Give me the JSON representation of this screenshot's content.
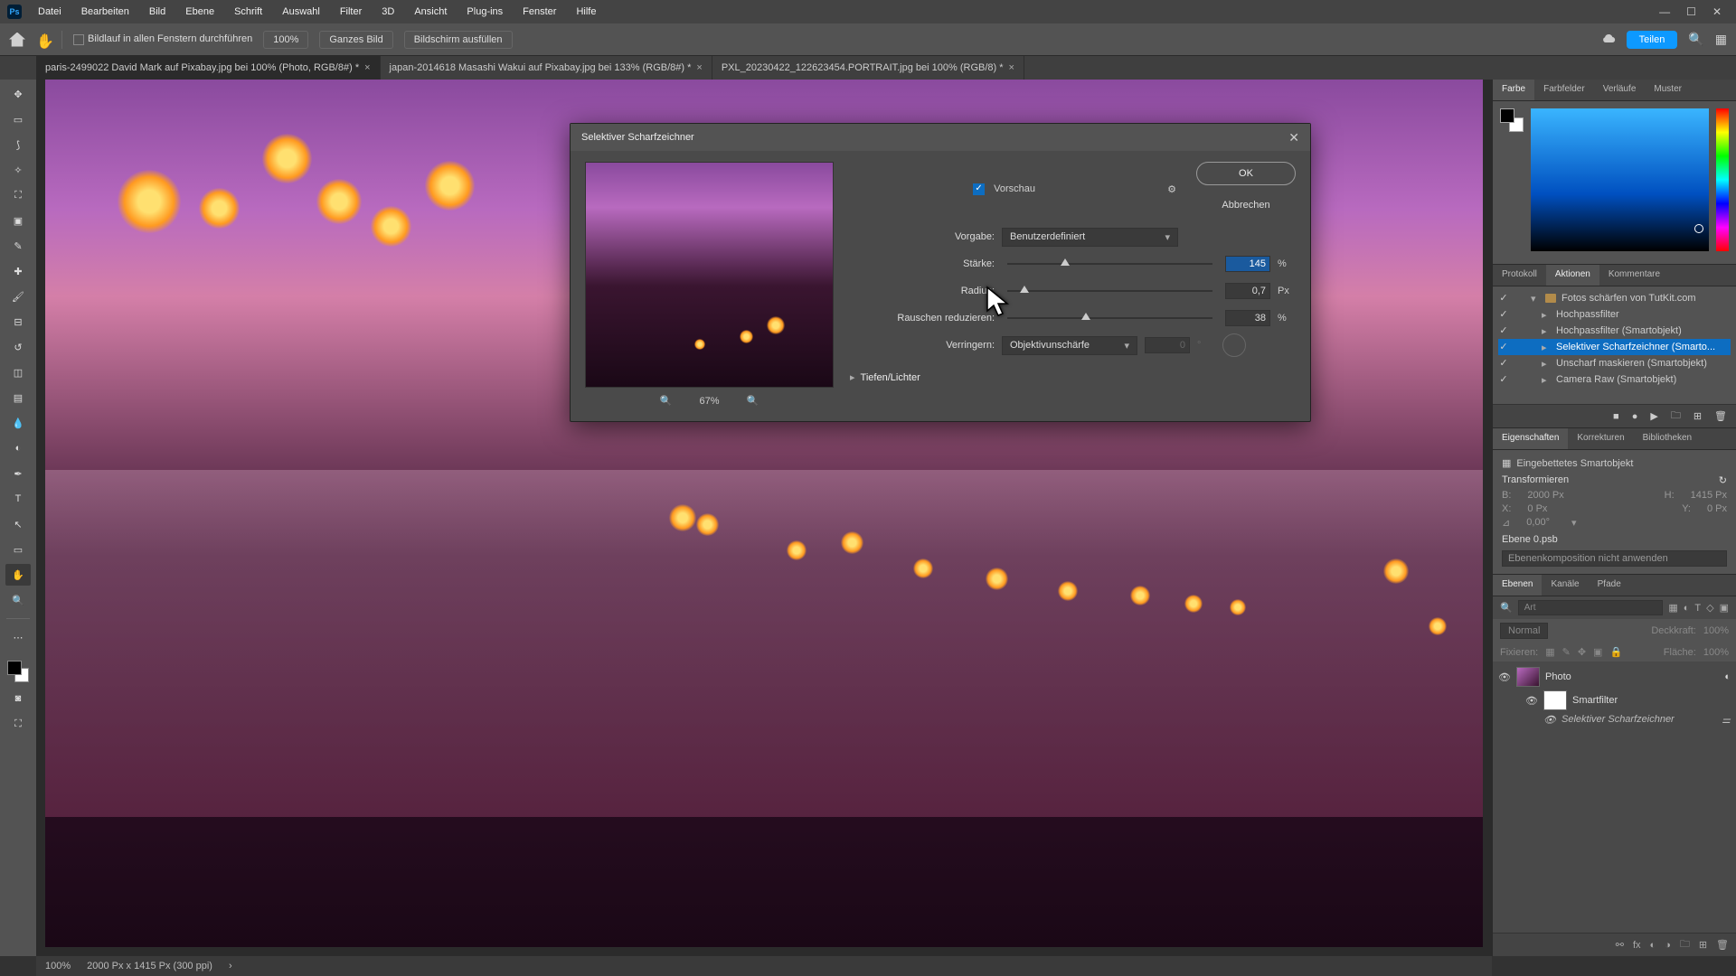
{
  "menubar": {
    "items": [
      "Datei",
      "Bearbeiten",
      "Bild",
      "Ebene",
      "Schrift",
      "Auswahl",
      "Filter",
      "3D",
      "Ansicht",
      "Plug-ins",
      "Fenster",
      "Hilfe"
    ]
  },
  "optbar": {
    "scroll_all": "Bildlauf in allen Fenstern durchführen",
    "zoom": "100%",
    "fit_all": "Ganzes Bild",
    "fill_screen": "Bildschirm ausfüllen",
    "share": "Teilen"
  },
  "tabs": [
    {
      "label": "paris-2499022  David Mark auf Pixabay.jpg bei 100% (Photo, RGB/8#) *",
      "active": true
    },
    {
      "label": "japan-2014618 Masashi Wakui auf Pixabay.jpg bei 133% (RGB/8#) *",
      "active": false
    },
    {
      "label": "PXL_20230422_122623454.PORTRAIT.jpg bei 100% (RGB/8) *",
      "active": false
    }
  ],
  "dialog": {
    "title": "Selektiver Scharfzeichner",
    "preview_chk": "Vorschau",
    "ok": "OK",
    "cancel": "Abbrechen",
    "preset_lbl": "Vorgabe:",
    "preset_val": "Benutzerdefiniert",
    "amount_lbl": "Stärke:",
    "amount_val": "145",
    "amount_unit": "%",
    "radius_lbl": "Radius:",
    "radius_val": "0,7",
    "radius_unit": "Px",
    "noise_lbl": "Rauschen reduzieren:",
    "noise_val": "38",
    "noise_unit": "%",
    "remove_lbl": "Verringern:",
    "remove_val": "Objektivunschärfe",
    "angle_val": "0",
    "angle_unit": "°",
    "section": "Tiefen/Lichter",
    "zoom_pct": "67%"
  },
  "right": {
    "color_tabs": [
      "Farbe",
      "Farbfelder",
      "Verläufe",
      "Muster"
    ],
    "actions_tabs": [
      "Protokoll",
      "Aktionen",
      "Kommentare"
    ],
    "actions": {
      "folder": "Fotos schärfen von TutKit.com",
      "items": [
        "Hochpassfilter",
        "Hochpassfilter (Smartobjekt)",
        "Selektiver Scharfzeichner (Smarto...",
        "Unscharf maskieren (Smartobjekt)",
        "Camera Raw (Smartobjekt)"
      ]
    },
    "props_tabs": [
      "Eigenschaften",
      "Korrekturen",
      "Bibliotheken"
    ],
    "props": {
      "embedded": "Eingebettetes Smartobjekt",
      "transform": "Transformieren",
      "w_lbl": "B:",
      "w": "2000 Px",
      "h_lbl": "H:",
      "h": "1415 Px",
      "x_lbl": "X:",
      "x": "0 Px",
      "y_lbl": "Y:",
      "y": "0 Px",
      "angle": "0,00°",
      "layer_file": "Ebene 0.psb",
      "comp_hint": "Ebenenkomposition nicht anwenden"
    },
    "layers_tabs": [
      "Ebenen",
      "Kanäle",
      "Pfade"
    ],
    "layers": {
      "search_ph": "Art",
      "blend": "Normal",
      "opacity_lbl": "Deckkraft:",
      "opacity": "100%",
      "lock_lbl": "Fixieren:",
      "fill_lbl": "Fläche:",
      "fill": "100%",
      "main": "Photo",
      "smart": "Smartfilter",
      "filter": "Selektiver Scharfzeichner"
    }
  },
  "status": {
    "zoom": "100%",
    "dims": "2000 Px x 1415 Px (300 ppi)"
  }
}
